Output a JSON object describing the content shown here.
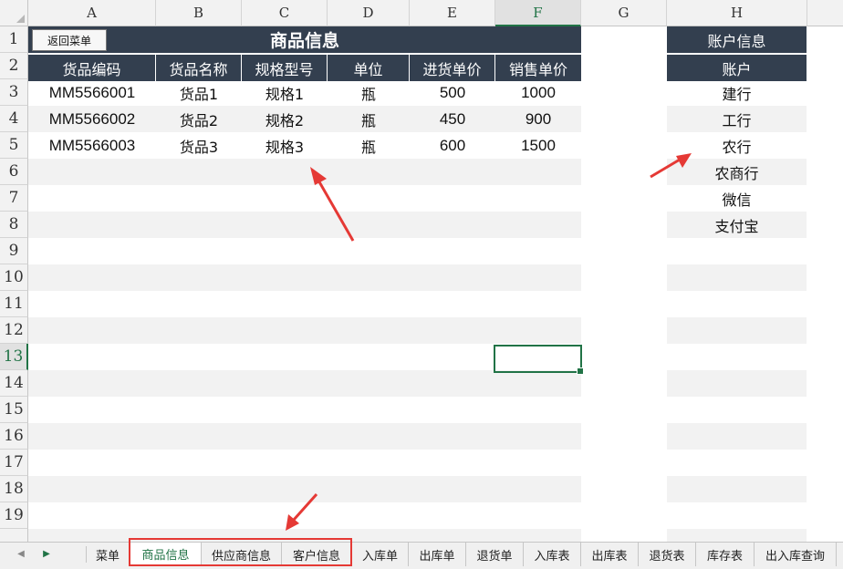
{
  "columns": [
    "A",
    "B",
    "C",
    "D",
    "E",
    "F",
    "G",
    "H"
  ],
  "rows": [
    "1",
    "2",
    "3",
    "4",
    "5",
    "6",
    "7",
    "8",
    "9",
    "10",
    "11",
    "12",
    "13",
    "14",
    "15",
    "16",
    "17",
    "18",
    "19"
  ],
  "active_column": "F",
  "active_row": "13",
  "back_button": {
    "label": "返回菜单"
  },
  "product_table": {
    "title": "商品信息",
    "headers": [
      "货品编码",
      "货品名称",
      "规格型号",
      "单位",
      "进货单价",
      "销售单价"
    ],
    "rows": [
      [
        "MM5566001",
        "货品1",
        "规格1",
        "瓶",
        "500",
        "1000"
      ],
      [
        "MM5566002",
        "货品2",
        "规格2",
        "瓶",
        "450",
        "900"
      ],
      [
        "MM5566003",
        "货品3",
        "规格3",
        "瓶",
        "600",
        "1500"
      ]
    ]
  },
  "account_table": {
    "title": "账户信息",
    "header": "账户",
    "items": [
      "建行",
      "工行",
      "农行",
      "农商行",
      "微信",
      "支付宝"
    ]
  },
  "sheet_tabs": [
    {
      "label": "菜单",
      "active": false
    },
    {
      "label": "商品信息",
      "active": true
    },
    {
      "label": "供应商信息",
      "active": false
    },
    {
      "label": "客户信息",
      "active": false
    },
    {
      "label": "入库单",
      "active": false
    },
    {
      "label": "出库单",
      "active": false
    },
    {
      "label": "退货单",
      "active": false
    },
    {
      "label": "入库表",
      "active": false
    },
    {
      "label": "出库表",
      "active": false
    },
    {
      "label": "退货表",
      "active": false
    },
    {
      "label": "库存表",
      "active": false
    },
    {
      "label": "出入库查询",
      "active": false
    }
  ],
  "icons": {
    "prev_sheet": "triangle-left-icon",
    "next_sheet": "triangle-right-icon",
    "select_all": "select-all-corner-icon"
  },
  "colors": {
    "header_bg": "#333f4f",
    "stripe": "#f2f2f2",
    "accent": "#217346",
    "annotation": "#e53935"
  }
}
